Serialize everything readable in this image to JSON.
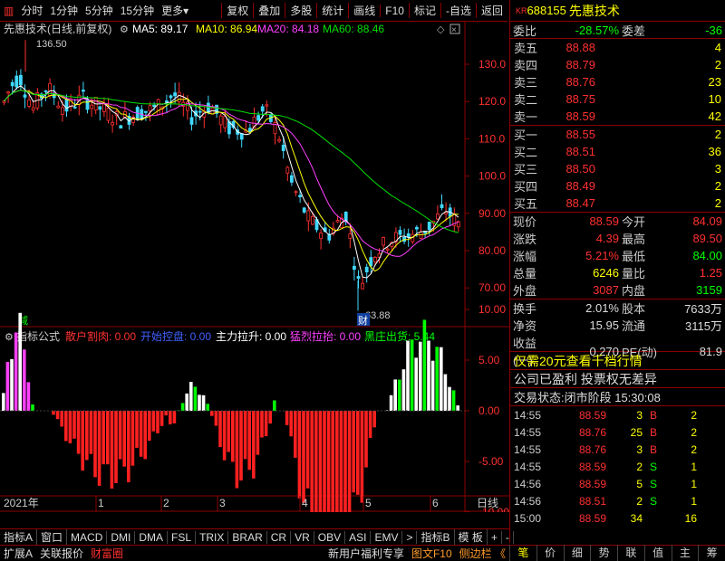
{
  "toolbar": {
    "periods": [
      "分时",
      "1分钟",
      "5分钟",
      "15分钟",
      "更多"
    ],
    "tools": [
      "复权",
      "叠加",
      "多股",
      "统计",
      "画线",
      "F10",
      "标记",
      "-自选",
      "返回"
    ]
  },
  "chart": {
    "title": "先惠技术(日线,前复权)",
    "ma": [
      {
        "label": "MA5: 89.17",
        "color": "#ffffff"
      },
      {
        "label": "MA10: 86.94",
        "color": "#ffff00"
      },
      {
        "label": "MA20: 84.18",
        "color": "#ff40ff"
      },
      {
        "label": "MA60: 88.46",
        "color": "#00e000"
      }
    ],
    "price_axis": [
      "130.0",
      "120.0",
      "110.0",
      "100.0",
      "90.00",
      "80.00",
      "70.00"
    ],
    "high_mark": "136.50",
    "low_mark": "63.88",
    "tag_jian": "减",
    "tag_cai": "财",
    "ind_title": "指标公式",
    "ind_items": [
      {
        "label": "散户割肉: 0.00",
        "color": "#ff3030"
      },
      {
        "label": "开始控盘: 0.00",
        "color": "#4060ff"
      },
      {
        "label": "主力拉升: 0.00",
        "color": "#ffffff"
      },
      {
        "label": "猛烈拉抬: 0.00",
        "color": "#ff40ff"
      },
      {
        "label": "黑庄出货: 5.44",
        "color": "#00ff00"
      }
    ],
    "ind_axis": [
      "10.00",
      "5.00",
      "0.00",
      "-5.00",
      "-10.00"
    ],
    "dates": [
      "2021年",
      "2",
      "3",
      "4",
      "5",
      "6"
    ],
    "date_num": "1",
    "date_end": "日线"
  },
  "chart_data": {
    "type": "candlestick",
    "ylim": [
      60,
      140
    ],
    "high": 136.5,
    "low": 63.88,
    "ma_last": {
      "MA5": 89.17,
      "MA10": 86.94,
      "MA20": 84.18,
      "MA60": 88.46
    }
  },
  "bottom_tabs": [
    "指标A",
    "窗口",
    "MACD",
    "DMI",
    "DMA",
    "FSL",
    "TRIX",
    "BRAR",
    "CR",
    "VR",
    "OBV",
    "ASI",
    "EMV",
    ">",
    "指标B",
    "模 板",
    "+",
    "-"
  ],
  "status": {
    "left": [
      "扩展A",
      "关联报价",
      "财富圈"
    ],
    "ad": "新用户福利专享",
    "f10": "图文F10",
    "side": "侧边栏 《"
  },
  "stock": {
    "kr": "KR",
    "code": "688155",
    "name": "先惠技术"
  },
  "weibi": {
    "l1": "委比",
    "v1": "-28.57%",
    "l2": "委差",
    "v2": "-36"
  },
  "sells": [
    {
      "l": "卖五",
      "p": "88.88",
      "v": "4"
    },
    {
      "l": "卖四",
      "p": "88.79",
      "v": "2"
    },
    {
      "l": "卖三",
      "p": "88.76",
      "v": "23"
    },
    {
      "l": "卖二",
      "p": "88.75",
      "v": "10"
    },
    {
      "l": "卖一",
      "p": "88.59",
      "v": "42"
    }
  ],
  "buys": [
    {
      "l": "买一",
      "p": "88.55",
      "v": "2"
    },
    {
      "l": "买二",
      "p": "88.51",
      "v": "36"
    },
    {
      "l": "买三",
      "p": "88.50",
      "v": "3"
    },
    {
      "l": "买四",
      "p": "88.49",
      "v": "2"
    },
    {
      "l": "买五",
      "p": "88.47",
      "v": "2"
    }
  ],
  "quote1": [
    [
      "现价",
      "88.59",
      "今开",
      "84.09"
    ],
    [
      "涨跌",
      "4.39",
      "最高",
      "89.50"
    ],
    [
      "涨幅",
      "5.21%",
      "最低",
      "84.00"
    ],
    [
      "总量",
      "6246",
      "量比",
      "1.25"
    ],
    [
      "外盘",
      "3087",
      "内盘",
      "3159"
    ]
  ],
  "quote2": [
    [
      "换手",
      "2.01%",
      "股本",
      "7633万"
    ],
    [
      "净资",
      "15.95",
      "流通",
      "3115万"
    ],
    [
      "收益(一)",
      "0.270",
      "PE(动)",
      "81.9"
    ]
  ],
  "promo": "仅需20元查看千档行情",
  "notice": "公司已盈利 投票权无差异",
  "trade_state": "交易状态:闭市阶段 15:30:08",
  "ticks": [
    [
      "14:55",
      "88.59",
      "3",
      "B",
      "2"
    ],
    [
      "14:55",
      "88.76",
      "25",
      "B",
      "2"
    ],
    [
      "14:55",
      "88.76",
      "3",
      "B",
      "2"
    ],
    [
      "14:55",
      "88.59",
      "2",
      "S",
      "1"
    ],
    [
      "14:56",
      "88.59",
      "5",
      "S",
      "1"
    ],
    [
      "14:56",
      "88.51",
      "2",
      "S",
      "1"
    ],
    [
      "15:00",
      "88.59",
      "34",
      "",
      "16"
    ]
  ],
  "right_tabs": [
    "笔",
    "价",
    "细",
    "势",
    "联",
    "值",
    "主",
    "筹"
  ]
}
